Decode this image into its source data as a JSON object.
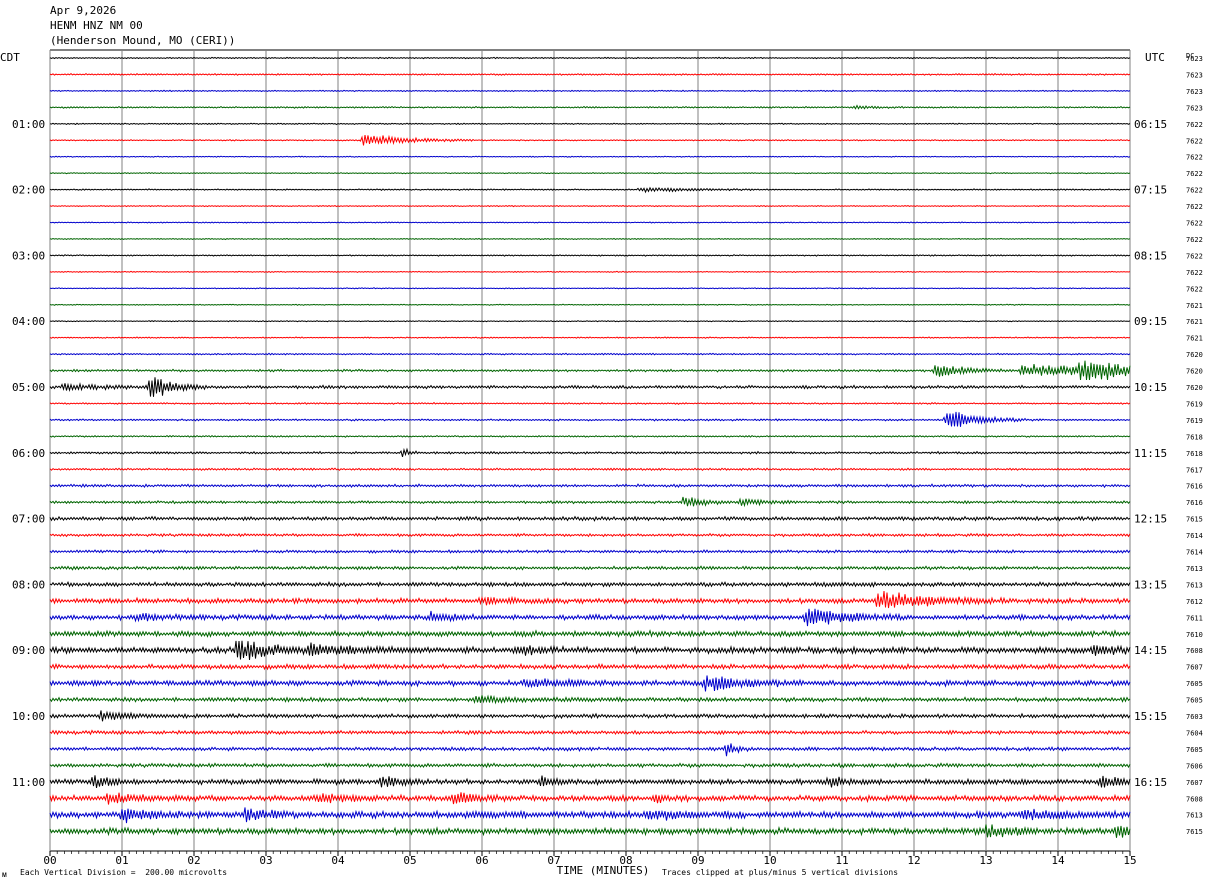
{
  "header": {
    "date": "Apr 9,2026",
    "station": "HENM HNZ NM 00",
    "location": "(Henderson Mound, MO (CERI))"
  },
  "left_timezone": "CDT",
  "right_timezone": "UTC",
  "dc_label": "DC",
  "footer": {
    "scale_note": "Each Vertical Division =  200.00 microvolts",
    "clip_note": "Traces clipped at plus/minus 5 vertical divisions",
    "corner_mark": "ᴍ"
  },
  "colors": {
    "black": "#000000",
    "red": "#ff0000",
    "blue": "#0000cc",
    "green": "#006400",
    "grid": "#808080"
  },
  "chart_data": {
    "type": "line",
    "title": "HENM HNZ NM 00",
    "xlabel": "TIME (MINUTES)",
    "xlim": [
      0,
      15
    ],
    "x_ticks": [
      "00",
      "01",
      "02",
      "03",
      "04",
      "05",
      "06",
      "07",
      "08",
      "09",
      "10",
      "11",
      "12",
      "13",
      "14",
      "15"
    ],
    "rows_count": 48,
    "trace_color_cycle": [
      "black",
      "red",
      "blue",
      "green"
    ],
    "left_hour_labels": [
      {
        "row": 4,
        "label": "01:00"
      },
      {
        "row": 8,
        "label": "02:00"
      },
      {
        "row": 12,
        "label": "03:00"
      },
      {
        "row": 16,
        "label": "04:00"
      },
      {
        "row": 20,
        "label": "05:00"
      },
      {
        "row": 24,
        "label": "06:00"
      },
      {
        "row": 28,
        "label": "07:00"
      },
      {
        "row": 32,
        "label": "08:00"
      },
      {
        "row": 36,
        "label": "09:00"
      },
      {
        "row": 40,
        "label": "10:00"
      },
      {
        "row": 44,
        "label": "11:00"
      }
    ],
    "right_hour_labels": [
      {
        "row": 4,
        "label": "06:15"
      },
      {
        "row": 8,
        "label": "07:15"
      },
      {
        "row": 12,
        "label": "08:15"
      },
      {
        "row": 16,
        "label": "09:15"
      },
      {
        "row": 20,
        "label": "10:15"
      },
      {
        "row": 24,
        "label": "11:15"
      },
      {
        "row": 28,
        "label": "12:15"
      },
      {
        "row": 32,
        "label": "13:15"
      },
      {
        "row": 36,
        "label": "14:15"
      },
      {
        "row": 40,
        "label": "15:15"
      },
      {
        "row": 44,
        "label": "16:15"
      }
    ],
    "dc_offsets": [
      "7623",
      "7623",
      "7623",
      "7623",
      "7622",
      "7622",
      "7622",
      "7622",
      "7622",
      "7622",
      "7622",
      "7622",
      "7622",
      "7622",
      "7622",
      "7621",
      "7621",
      "7621",
      "7620",
      "7620",
      "7620",
      "7619",
      "7619",
      "7618",
      "7618",
      "7617",
      "7616",
      "7616",
      "7615",
      "7614",
      "7614",
      "7613",
      "7613",
      "7612",
      "7611",
      "7610",
      "7608",
      "7607",
      "7605",
      "7605",
      "7603",
      "7604",
      "7605",
      "7606",
      "7607",
      "7608",
      "7613",
      "7615"
    ],
    "row_noise": [
      0.5,
      0.6,
      0.5,
      0.6,
      0.5,
      0.5,
      0.4,
      0.4,
      0.5,
      0.4,
      0.4,
      0.4,
      0.5,
      0.4,
      0.4,
      0.4,
      0.4,
      0.5,
      0.6,
      0.9,
      1.2,
      0.6,
      0.7,
      0.6,
      0.9,
      0.8,
      1.1,
      1.0,
      1.5,
      1.1,
      1.1,
      1.3,
      1.6,
      2.0,
      2.0,
      2.2,
      2.4,
      1.8,
      2.2,
      1.6,
      1.6,
      1.4,
      1.4,
      1.5,
      2.0,
      2.3,
      2.6,
      2.5
    ],
    "events": [
      {
        "row": 3,
        "t": 11.2,
        "amp": 2,
        "dur": 0.3
      },
      {
        "row": 5,
        "t": 4.35,
        "amp": 8,
        "dur": 0.7
      },
      {
        "row": 8,
        "t": 8.2,
        "amp": 3,
        "dur": 0.8
      },
      {
        "row": 19,
        "t": 12.3,
        "amp": 8,
        "dur": 0.5
      },
      {
        "row": 19,
        "t": 13.5,
        "amp": 8,
        "dur": 1.4
      },
      {
        "row": 19,
        "t": 14.3,
        "amp": 12,
        "dur": 0.8
      },
      {
        "row": 20,
        "t": 0.2,
        "amp": 3,
        "dur": 0.8
      },
      {
        "row": 20,
        "t": 1.4,
        "amp": 16,
        "dur": 0.35
      },
      {
        "row": 22,
        "t": 12.45,
        "amp": 14,
        "dur": 0.5
      },
      {
        "row": 24,
        "t": 4.9,
        "amp": 6,
        "dur": 0.1
      },
      {
        "row": 27,
        "t": 8.8,
        "amp": 6,
        "dur": 0.4
      },
      {
        "row": 27,
        "t": 9.6,
        "amp": 4,
        "dur": 0.4
      },
      {
        "row": 33,
        "t": 11.5,
        "amp": 11,
        "dur": 0.8
      },
      {
        "row": 33,
        "t": 6.0,
        "amp": 3,
        "dur": 0.6
      },
      {
        "row": 34,
        "t": 10.5,
        "amp": 12,
        "dur": 0.6
      },
      {
        "row": 34,
        "t": 5.3,
        "amp": 5,
        "dur": 0.3
      },
      {
        "row": 34,
        "t": 1.2,
        "amp": 4,
        "dur": 0.4
      },
      {
        "row": 36,
        "t": 2.6,
        "amp": 13,
        "dur": 0.5
      },
      {
        "row": 36,
        "t": 3.6,
        "amp": 6,
        "dur": 0.8
      },
      {
        "row": 36,
        "t": 6.5,
        "amp": 5,
        "dur": 0.4
      },
      {
        "row": 36,
        "t": 14.5,
        "amp": 5,
        "dur": 0.4
      },
      {
        "row": 38,
        "t": 9.1,
        "amp": 9,
        "dur": 0.6
      },
      {
        "row": 38,
        "t": 6.6,
        "amp": 4,
        "dur": 0.6
      },
      {
        "row": 39,
        "t": 5.9,
        "amp": 4,
        "dur": 0.6
      },
      {
        "row": 40,
        "t": 0.7,
        "amp": 5,
        "dur": 0.5
      },
      {
        "row": 42,
        "t": 9.4,
        "amp": 9,
        "dur": 0.15
      },
      {
        "row": 44,
        "t": 0.6,
        "amp": 6,
        "dur": 0.3
      },
      {
        "row": 44,
        "t": 4.6,
        "amp": 6,
        "dur": 0.3
      },
      {
        "row": 44,
        "t": 6.8,
        "amp": 5,
        "dur": 0.3
      },
      {
        "row": 44,
        "t": 10.8,
        "amp": 5,
        "dur": 0.3
      },
      {
        "row": 44,
        "t": 14.6,
        "amp": 8,
        "dur": 0.3
      },
      {
        "row": 45,
        "t": 0.8,
        "amp": 6,
        "dur": 0.4
      },
      {
        "row": 45,
        "t": 3.7,
        "amp": 5,
        "dur": 0.6
      },
      {
        "row": 45,
        "t": 5.6,
        "amp": 6,
        "dur": 0.4
      },
      {
        "row": 45,
        "t": 8.4,
        "amp": 4,
        "dur": 0.2
      },
      {
        "row": 46,
        "t": 1.0,
        "amp": 7,
        "dur": 0.4
      },
      {
        "row": 46,
        "t": 2.7,
        "amp": 7,
        "dur": 0.4
      },
      {
        "row": 46,
        "t": 8.3,
        "amp": 5,
        "dur": 0.6
      },
      {
        "row": 46,
        "t": 13.5,
        "amp": 5,
        "dur": 0.8
      },
      {
        "row": 47,
        "t": 13.0,
        "amp": 6,
        "dur": 0.4
      },
      {
        "row": 47,
        "t": 14.8,
        "amp": 6,
        "dur": 0.3
      }
    ]
  }
}
